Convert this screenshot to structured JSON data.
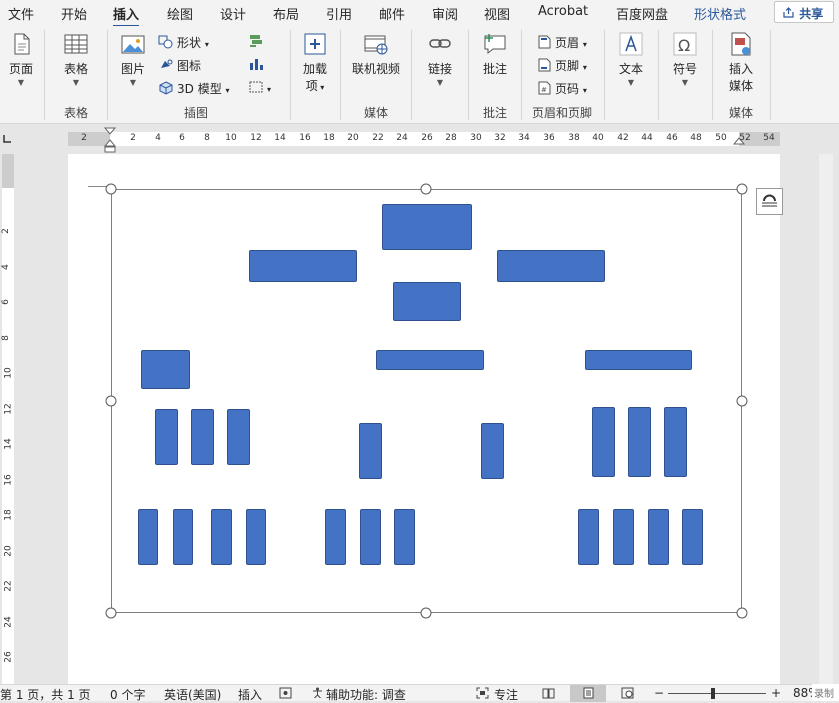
{
  "tabs": [
    {
      "label": "文件"
    },
    {
      "label": "开始"
    },
    {
      "label": "插入"
    },
    {
      "label": "绘图"
    },
    {
      "label": "设计"
    },
    {
      "label": "布局"
    },
    {
      "label": "引用"
    },
    {
      "label": "邮件"
    },
    {
      "label": "审阅"
    },
    {
      "label": "视图"
    },
    {
      "label": "Acrobat"
    },
    {
      "label": "百度网盘"
    },
    {
      "label": "形状格式"
    }
  ],
  "share_label": "共享",
  "ribbon": {
    "pages": {
      "button": "页面",
      "group": ""
    },
    "tables": {
      "button": "表格",
      "group": "表格"
    },
    "illustrations": {
      "picture": "图片",
      "shapes": "形状",
      "icons": "图标",
      "model3d": "3D 模型",
      "group": "插图"
    },
    "addins": {
      "button_line1": "加载",
      "button_line2": "项"
    },
    "media": {
      "online_video": "联机视频",
      "group": "媒体"
    },
    "links": {
      "button": "链接"
    },
    "comments": {
      "button": "批注",
      "group": "批注"
    },
    "header_footer": {
      "header": "页眉",
      "footer": "页脚",
      "page_number": "页码",
      "group": "页眉和页脚"
    },
    "text": {
      "button": "文本"
    },
    "symbols": {
      "button": "符号"
    },
    "insert_media": {
      "line1": "插入",
      "line2": "媒体",
      "group": "媒体"
    }
  },
  "ruler": {
    "horizontal": [
      "2",
      "2",
      "4",
      "6",
      "8",
      "10",
      "12",
      "14",
      "16",
      "18",
      "20",
      "22",
      "24",
      "26",
      "28",
      "30",
      "32",
      "34",
      "36",
      "38",
      "40",
      "42",
      "44",
      "46",
      "48",
      "50",
      "52",
      "54"
    ],
    "vertical": [
      "2",
      "4",
      "6",
      "8",
      "10",
      "12",
      "14",
      "16",
      "18",
      "20",
      "22",
      "24",
      "26"
    ]
  },
  "status": {
    "page": "第 1 页，共 1 页",
    "words": "0 个字",
    "language": "英语(美国)",
    "mode": "插入",
    "accessibility": "辅助功能: 调查",
    "focus": "专注",
    "zoom": "88%",
    "record": "录制"
  },
  "colors": {
    "accent": "#2b579a",
    "shape_fill": "#4472c4",
    "shape_border": "#2f528f"
  },
  "icons": [
    "page-icon",
    "table-icon",
    "picture-icon",
    "shapes-icon",
    "icons-icon",
    "model3d-icon",
    "smartart-icon",
    "chart-icon",
    "screenshot-icon",
    "addins-icon",
    "online-video-icon",
    "link-icon",
    "comment-icon",
    "header-icon",
    "footer-icon",
    "page-number-icon",
    "text-icon",
    "symbol-icon",
    "insert-media-icon",
    "layout-options-icon"
  ]
}
